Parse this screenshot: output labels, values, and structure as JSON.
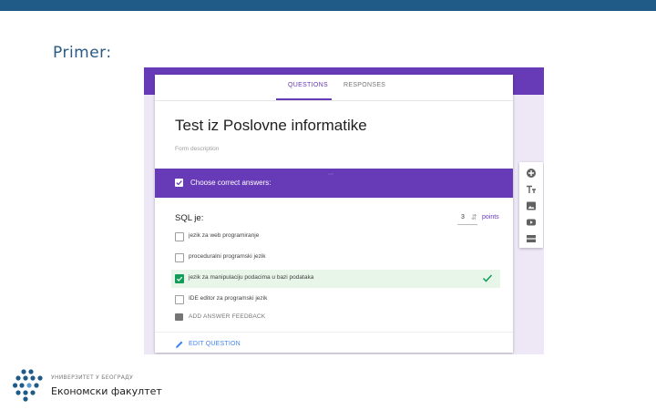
{
  "slide": {
    "title": "Primer:"
  },
  "form": {
    "tabs": [
      {
        "label": "QUESTIONS"
      },
      {
        "label": "RESPONSES"
      }
    ],
    "title": "Test iz Poslovne informatike",
    "description_placeholder": "Form description",
    "section_header": "Choose correct answers:",
    "question": {
      "title": "SQL je:",
      "points_value": "3",
      "points_label": "points",
      "options": [
        {
          "label": "jezik za web programiranje",
          "correct": false
        },
        {
          "label": "proceduralni programski jezik",
          "correct": false
        },
        {
          "label": "jezik za manipulaciju podacima u bazi podataka",
          "correct": true
        },
        {
          "label": "IDE editor za programski jezik",
          "correct": false
        }
      ],
      "feedback_label": "ADD ANSWER FEEDBACK",
      "edit_label": "EDIT QUESTION"
    },
    "toolbar_icons": [
      "add-circle-icon",
      "title-text-icon",
      "image-icon",
      "video-icon",
      "section-icon"
    ],
    "accent_color": "#673ab7",
    "correct_color": "#0f9d58"
  },
  "branding": {
    "university": "УНИВЕРЗИТЕТ У БЕОГРАДУ",
    "faculty": "Економски факултет"
  }
}
